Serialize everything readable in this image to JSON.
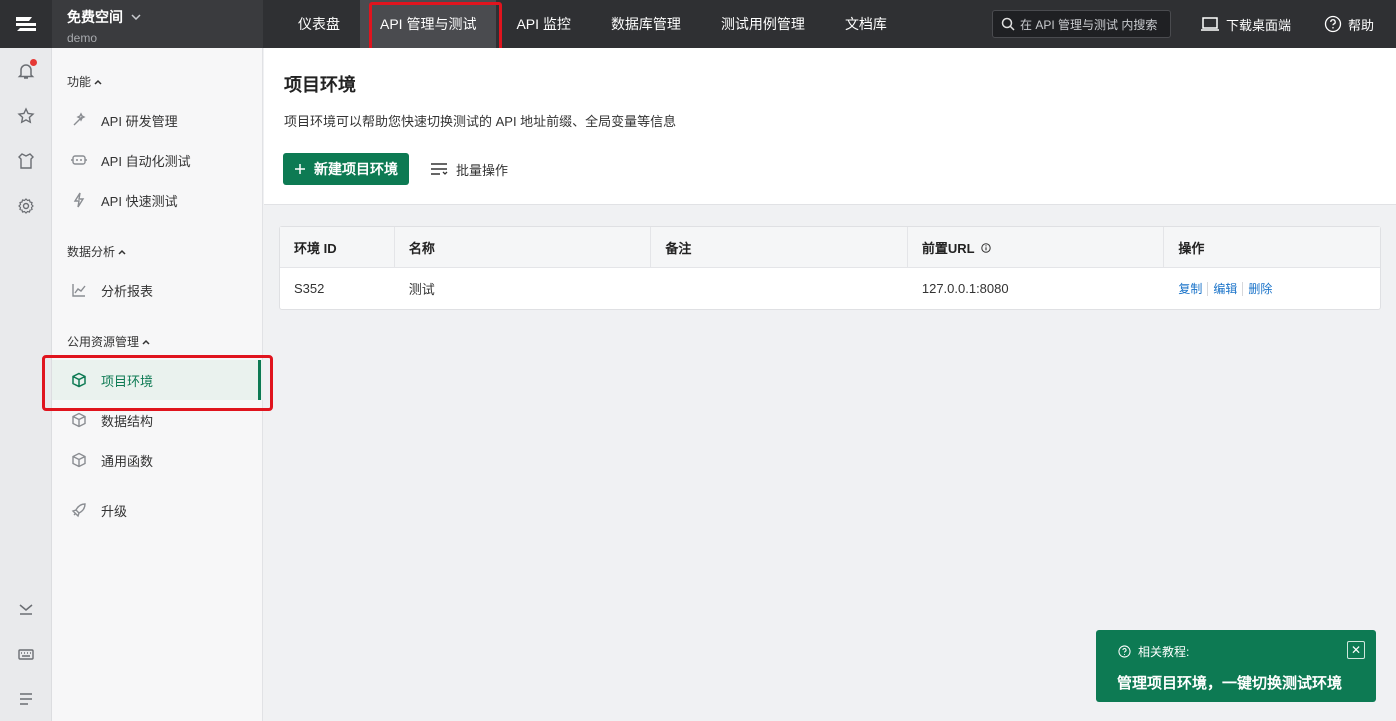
{
  "workspace": {
    "name": "免费空间",
    "sub": "demo"
  },
  "nav": {
    "items": [
      {
        "label": "仪表盘"
      },
      {
        "label": "API 管理与测试"
      },
      {
        "label": "API 监控"
      },
      {
        "label": "数据库管理"
      },
      {
        "label": "测试用例管理"
      },
      {
        "label": "文档库"
      }
    ],
    "active_index": 1
  },
  "search": {
    "placeholder": "在 API 管理与测试 内搜索"
  },
  "top_right": {
    "download": "下载桌面端",
    "help": "帮助"
  },
  "sidebar": {
    "groups": [
      {
        "label": "功能"
      },
      {
        "label": "数据分析"
      },
      {
        "label": "公用资源管理"
      }
    ],
    "items": [
      {
        "label": "API 研发管理"
      },
      {
        "label": "API 自动化测试"
      },
      {
        "label": "API 快速测试"
      },
      {
        "label": "分析报表"
      },
      {
        "label": "项目环境"
      },
      {
        "label": "数据结构"
      },
      {
        "label": "通用函数"
      },
      {
        "label": "升级"
      }
    ]
  },
  "page": {
    "title": "项目环境",
    "description": "项目环境可以帮助您快速切换测试的 API 地址前缀、全局变量等信息",
    "new_button": "新建项目环境",
    "batch_button": "批量操作"
  },
  "table": {
    "headers": [
      "环境 ID",
      "名称",
      "备注",
      "前置URL",
      "操作"
    ],
    "rows": [
      {
        "id": "S352",
        "name": "测试",
        "note": "",
        "url": "127.0.0.1:8080"
      }
    ],
    "actions": [
      "复制",
      "编辑",
      "删除"
    ]
  },
  "toast": {
    "sub": "相关教程:",
    "main": "管理项目环境，一键切换测试环境"
  },
  "colors": {
    "brand": "#0d7a53",
    "topbar": "#2f3033",
    "highlight": "#e0141e",
    "link": "#1a73c9"
  }
}
